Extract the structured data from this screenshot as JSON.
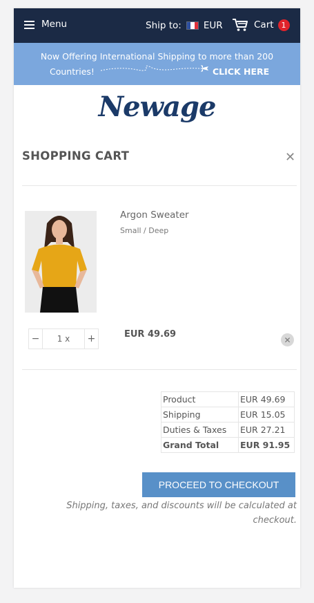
{
  "colors": {
    "topbar": "#1b2a45",
    "promo": "#7ba7dd",
    "brand": "#1b3a68",
    "checkout": "#5890c8",
    "badge": "#e0232b"
  },
  "header": {
    "menu_label": "Menu",
    "ship_to_label": "Ship to:",
    "currency": "EUR",
    "cart_label": "Cart",
    "cart_count": "1"
  },
  "promo": {
    "line1": "Now Offering International Shipping to more than 200",
    "line2": "Countries!",
    "cta": "CLICK HERE"
  },
  "brand": {
    "logo_text": "Newage"
  },
  "cart": {
    "title": "SHOPPING CART",
    "item": {
      "name": "Argon Sweater",
      "variant": "Small / Deep",
      "quantity": "1 x",
      "price": "EUR 49.69",
      "image": "woman-in-yellow-sweater"
    },
    "totals": [
      {
        "label": "Product",
        "value": "EUR 49.69"
      },
      {
        "label": "Shipping",
        "value": "EUR 15.05"
      },
      {
        "label": "Duties & Taxes",
        "value": "EUR 27.21"
      },
      {
        "label": "Grand Total",
        "value": "EUR 91.95"
      }
    ],
    "checkout_label": "PROCEED TO CHECKOUT",
    "note": "Shipping, taxes, and discounts will be calculated at checkout."
  }
}
